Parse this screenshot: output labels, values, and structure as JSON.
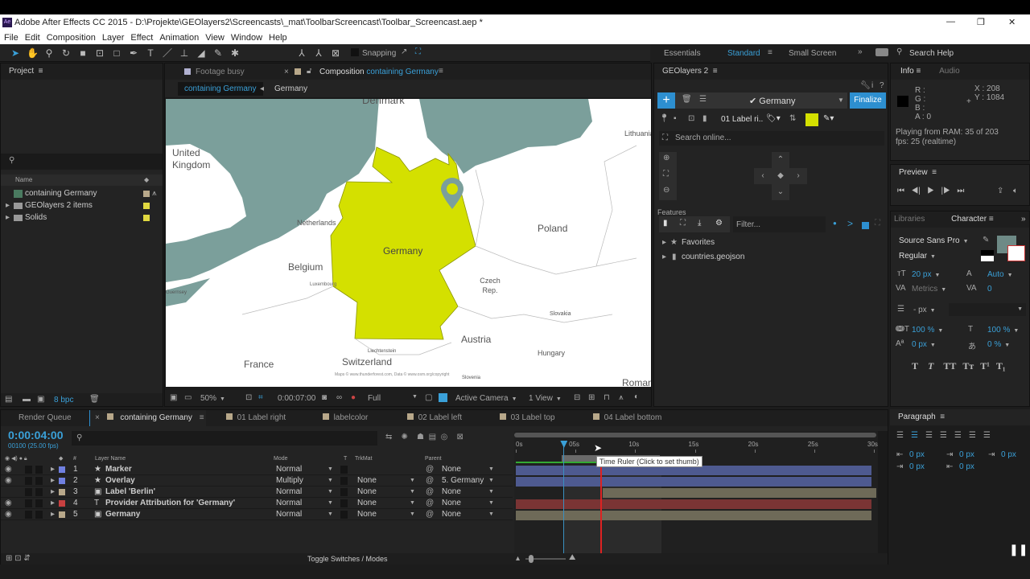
{
  "window": {
    "title": "Adobe After Effects CC 2015 - D:\\Projekte\\GEOlayers2\\Screencasts\\_mat\\ToolbarScreencast\\Toolbar_Screencast.aep *",
    "app_icon": "Ae",
    "controls": [
      "—",
      "❐",
      "✕"
    ]
  },
  "menu": [
    "File",
    "Edit",
    "Composition",
    "Layer",
    "Effect",
    "Animation",
    "View",
    "Window",
    "Help"
  ],
  "toolbar": {
    "snapping": "Snapping",
    "workspaces": [
      "Essentials",
      "Standard",
      "Small Screen"
    ],
    "active_workspace": "Standard",
    "search_help": "Search Help"
  },
  "project": {
    "title": "Project",
    "col_name": "Name",
    "items": [
      {
        "name": "containing Germany",
        "type": "comp",
        "color": "#b8a88a"
      },
      {
        "name": "GEOlayers 2 items",
        "type": "folder",
        "color": "#e0d840"
      },
      {
        "name": "Solids",
        "type": "folder",
        "color": "#e0d840"
      }
    ],
    "bpc": "8 bpc"
  },
  "composition": {
    "tabs": [
      {
        "label": "Footage busy"
      },
      {
        "label": "Composition",
        "name": "containing Germany"
      }
    ],
    "breadcrumbs": [
      "containing Germany",
      "Germany"
    ],
    "map_labels": [
      "Denmark",
      "United Kingdom",
      "Netherlands",
      "Belgium",
      "Luxembourg",
      "Guernsey",
      "Germany",
      "Poland",
      "Lithuania",
      "Czech Rep.",
      "Slovakia",
      "Austria",
      "Hungary",
      "Switzerland",
      "Liechtenstein",
      "France",
      "Slovenia",
      "Roman",
      "Maps © www.thunderforest.com, Data © www.osm.org/copyright"
    ],
    "footer": {
      "zoom": "50%",
      "timecode": "0:00:07:00",
      "resolution": "Full",
      "camera": "Active Camera",
      "views": "1 View"
    }
  },
  "geolayers": {
    "title": "GEOlayers 2",
    "map_name": "Germany",
    "finalize": "Finalize",
    "label_preset": "01 Label ri..",
    "label_color": "#d4e000",
    "search_placeholder": "Search online...",
    "features_title": "Features",
    "filter_placeholder": "Filter...",
    "tree": [
      "Favorites",
      "countries.geojson"
    ]
  },
  "info": {
    "tabs": [
      "Info",
      "Audio"
    ],
    "r": "R :",
    "g": "G :",
    "b": "B :",
    "a": "A : 0",
    "x": "X : 208",
    "y": "Y : 1084",
    "status1": "Playing from RAM: 35 of 203",
    "status2": "fps: 25 (realtime)"
  },
  "preview": {
    "title": "Preview"
  },
  "character": {
    "tabs": [
      "Libraries",
      "Character"
    ],
    "font": "Source Sans Pro",
    "style": "Regular",
    "size": "20 px",
    "leading": "Auto",
    "kerning": "Metrics",
    "tracking": "0",
    "stroke": "- px",
    "vscale": "100 %",
    "hscale": "100 %",
    "baseline": "0 px",
    "tsume": "0 %",
    "fill_color": "#6e8a86",
    "styles": [
      "T",
      "T",
      "TT",
      "Tт",
      "T¹",
      "T₁"
    ]
  },
  "paragraph": {
    "title": "Paragraph",
    "indent_left": "0 px",
    "indent_first": "0 px",
    "indent_right": "0 px",
    "space_before": "0 px",
    "space_after": "0 px"
  },
  "timeline": {
    "tabs": [
      "Render Queue",
      "containing Germany",
      "01 Label right",
      "labelcolor",
      "02 Label left",
      "03 Label top",
      "04 Label bottom"
    ],
    "timecode": "0:00:04:00",
    "frame_info": "00100 (25.00 fps)",
    "columns": {
      "num": "#",
      "name": "Layer Name",
      "mode": "Mode",
      "t": "T",
      "trkmat": "TrkMat",
      "parent": "Parent"
    },
    "ruler": [
      "0s",
      "05s",
      "10s",
      "15s",
      "20s",
      "25s",
      "30s"
    ],
    "duration_s": 30,
    "current_s": 4,
    "red_marker_s": 7.1,
    "work_area_end_s": 12.2,
    "tooltip": "Time Ruler (Click to set thumb)",
    "toggle": "Toggle Switches / Modes",
    "layers": [
      {
        "num": "1",
        "name": "Marker",
        "icon": "★",
        "color": "#7080e0",
        "mode": "Normal",
        "trkmat": "",
        "parent": "None",
        "bar_color": "#4e5a90",
        "start_s": 0,
        "end_s": 29.8
      },
      {
        "num": "2",
        "name": "Overlay",
        "icon": "★",
        "color": "#7080e0",
        "mode": "Multiply",
        "trkmat": "None",
        "parent": "5. Germany",
        "bar_color": "#4e5a90",
        "start_s": 0,
        "end_s": 29.8
      },
      {
        "num": "3",
        "name": "Label 'Berlin'",
        "icon": "▣",
        "color": "#b8a88a",
        "mode": "Normal",
        "trkmat": "None",
        "parent": "None",
        "bar_color": "#6e6a58",
        "start_s": 7.3,
        "end_s": 30.2
      },
      {
        "num": "4",
        "name": "Provider Attribution for 'Germany'",
        "icon": "T",
        "color": "#c84040",
        "mode": "Normal",
        "trkmat": "None",
        "parent": "None",
        "bar_color": "#7a3434",
        "start_s": 0,
        "end_s": 29.8
      },
      {
        "num": "5",
        "name": "Germany",
        "icon": "▣",
        "color": "#b8a88a",
        "mode": "Normal",
        "trkmat": "None",
        "parent": "None",
        "bar_color": "#6e6a58",
        "start_s": 0,
        "end_s": 29.8
      }
    ]
  }
}
